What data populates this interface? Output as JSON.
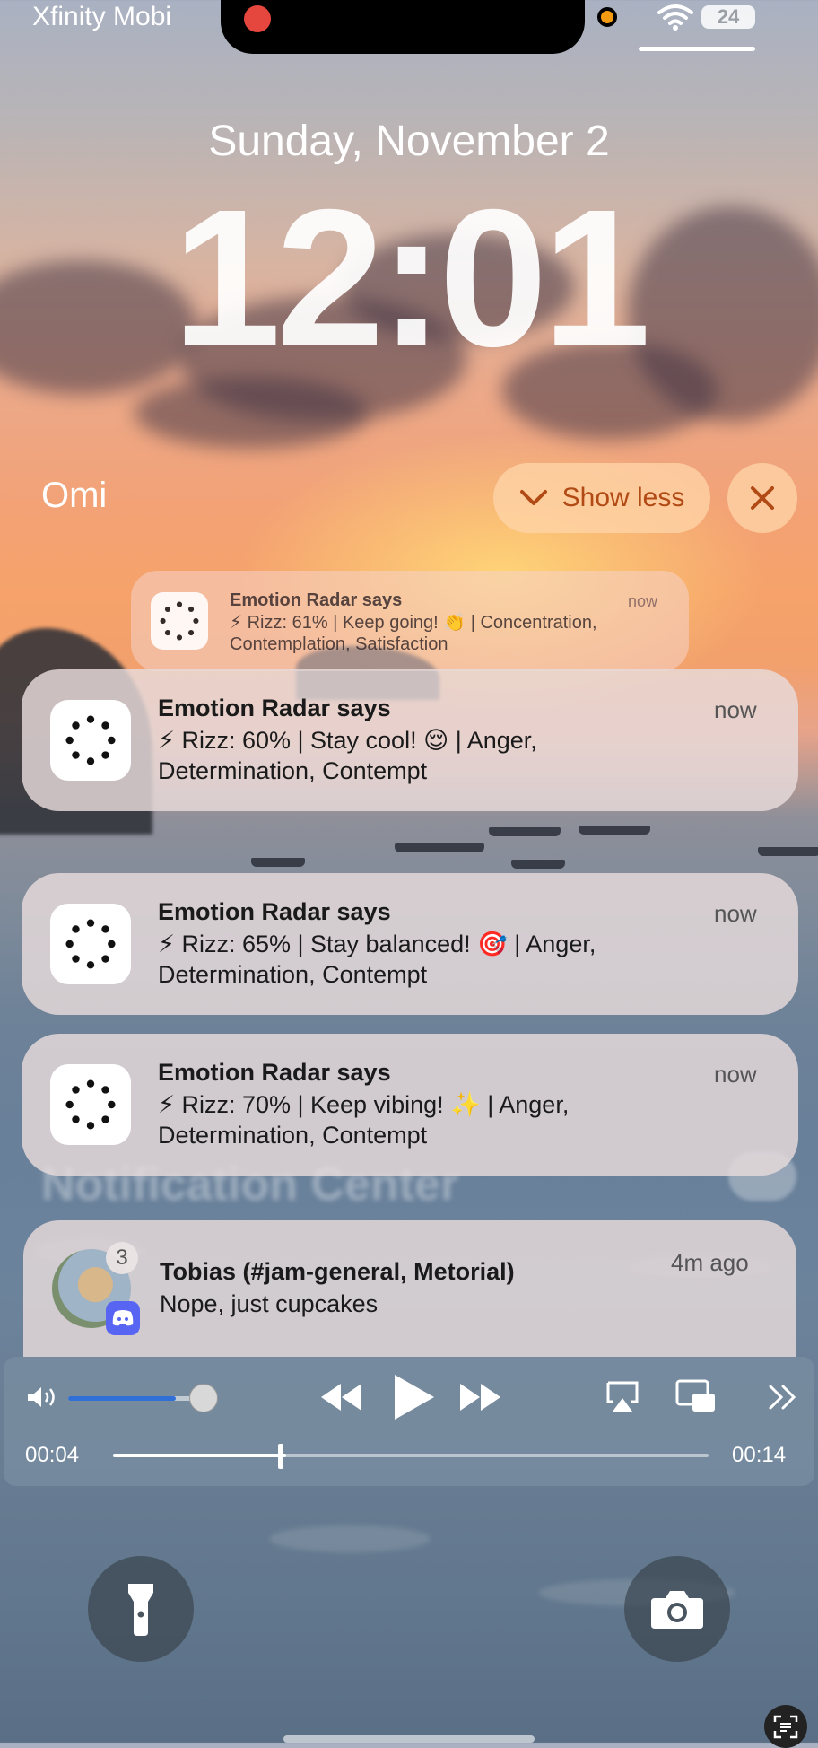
{
  "status_bar": {
    "carrier": "Xfinity Mobi",
    "battery": "24"
  },
  "lock_screen": {
    "date": "Sunday, November 2",
    "time": "12:01"
  },
  "notification_group": {
    "app_name": "Omi",
    "show_less_label": "Show less",
    "stacked_preview": {
      "title": "Emotion Radar says",
      "timestamp": "now",
      "body": "⚡ Rizz: 61% | Keep going! 👏 | Concentration, Contemplation, Satisfaction"
    },
    "items": [
      {
        "title": "Emotion Radar says",
        "timestamp": "now",
        "line1": "⚡ Rizz: 60% | Stay cool! 😌 | Anger,",
        "line2": "Determination, Contempt"
      },
      {
        "title": "Emotion Radar says",
        "timestamp": "now",
        "line1": "⚡ Rizz: 65% | Stay balanced! 🎯 | Anger,",
        "line2": "Determination, Contempt"
      },
      {
        "title": "Emotion Radar says",
        "timestamp": "now",
        "line1": "⚡ Rizz: 70% | Keep vibing! ✨ | Anger,",
        "line2": "Determination, Contempt"
      }
    ]
  },
  "notification_center_label": "Notification Center",
  "discord_notification": {
    "title": "Tobias (#jam-general, Metorial)",
    "body": "Nope, just cupcakes",
    "timestamp": "4m ago",
    "badge": "3"
  },
  "media_player": {
    "elapsed": "00:04",
    "duration": "00:14",
    "volume_level": 0.75,
    "progress": 0.29
  },
  "colors": {
    "show_less_text": "#b14a14",
    "volume_fill": "#2f6fd6",
    "record_dot": "#e5463e",
    "discord": "#5865f2"
  }
}
